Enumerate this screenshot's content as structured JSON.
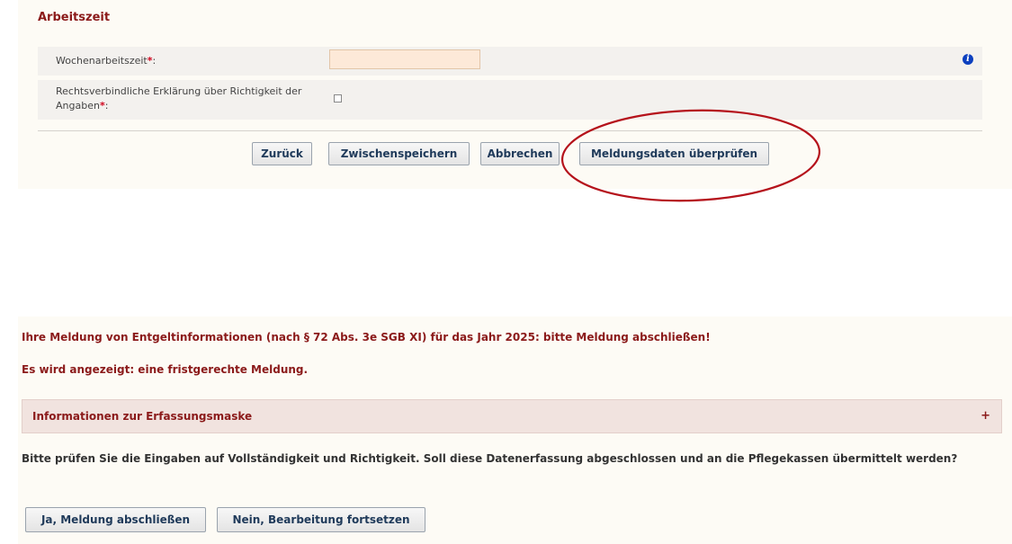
{
  "section": {
    "title": "Arbeitszeit",
    "fields": [
      {
        "label": "Wochenarbeitszeit",
        "required_marker": "*",
        "suffix": ":",
        "value": ""
      },
      {
        "label": "Rechtsverbindliche Erklärung über Richtigkeit der Angaben",
        "required_marker": "*",
        "suffix": ":",
        "checked": false
      }
    ]
  },
  "buttons": {
    "back": "Zurück",
    "save_draft": "Zwischenspeichern",
    "cancel": "Abbrechen",
    "check": "Meldungsdaten überprüfen"
  },
  "highlight": {
    "color": "#b5121b"
  },
  "confirm": {
    "heading": "Ihre Meldung von Entgeltinformationen (nach § 72 Abs. 3e SGB XI) für das Jahr 2025: bitte Meldung abschließen!",
    "status": "Es wird angezeigt: eine fristgerechte Meldung.",
    "accordion": {
      "label": "Informationen zur Erfassungsmaske",
      "icon": "+"
    },
    "question": "Bitte prüfen Sie die Eingaben auf Vollständigkeit und Richtigkeit. Soll diese Datenerfassung abgeschlossen und an die Pflegekassen übermittelt werden?",
    "yes": "Ja, Meldung abschließen",
    "no": "Nein, Bearbeitung fortsetzen"
  },
  "colors": {
    "accent": "#8b1a1a",
    "panel_bg": "#fdfbf5",
    "row_bg": "#f3f1ee",
    "input_bg": "#fde9d8",
    "accordion_bg": "#f1e3df",
    "info_icon": "#0b3fbf"
  }
}
